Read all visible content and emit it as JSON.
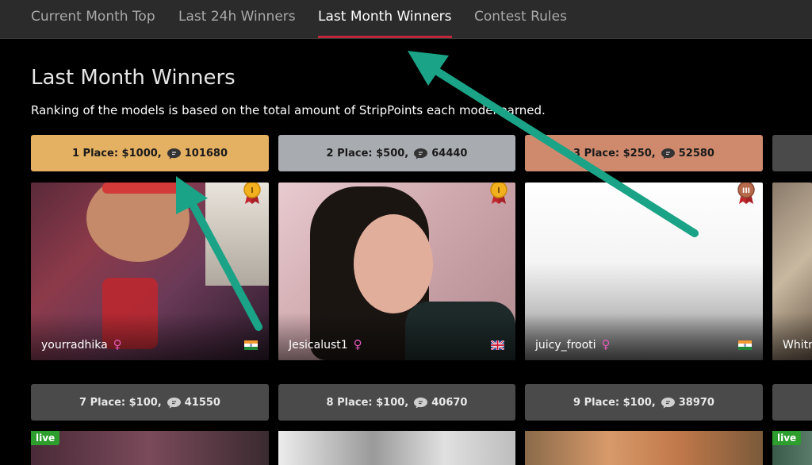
{
  "nav": {
    "tabs": [
      {
        "label": "Current Month Top"
      },
      {
        "label": "Last 24h Winners"
      },
      {
        "label": "Last Month Winners",
        "active": true
      },
      {
        "label": "Contest Rules"
      }
    ]
  },
  "main": {
    "title": "Last Month Winners",
    "subtitle": "Ranking of the models is based on the total amount of StripPoints each model earned."
  },
  "places_row1": [
    {
      "text": "1 Place: $1000,",
      "points": "101680",
      "color": "#e4b062"
    },
    {
      "text": "2 Place: $500,",
      "points": "64440",
      "color": "#a8abb0"
    },
    {
      "text": "3 Place: $250,",
      "points": "52580",
      "color": "#cf8a6e"
    }
  ],
  "models_row1": [
    {
      "name": "yourradhika",
      "gender_symbol": "♀",
      "flag": "india-flag",
      "medal": "gold-medal"
    },
    {
      "name": "Jesicalust1",
      "gender_symbol": "♀",
      "flag": "uk-flag",
      "medal": "gold-medal"
    },
    {
      "name": "juicy_frooti",
      "gender_symbol": "♀",
      "flag": "india-flag",
      "medal": "bronze-medal-III"
    },
    {
      "name": "Whitn",
      "gender_symbol": "",
      "flag": "",
      "medal": ""
    }
  ],
  "places_row2": [
    {
      "text": "7 Place: $100,",
      "points": "41550",
      "color": "#4a4a4a"
    },
    {
      "text": "8 Place: $100,",
      "points": "40670",
      "color": "#4a4a4a"
    },
    {
      "text": "9 Place: $100,",
      "points": "38970",
      "color": "#4a4a4a"
    }
  ],
  "badges": {
    "live": "live"
  },
  "medal_labels": {
    "gold": "I",
    "bronze": "III"
  }
}
